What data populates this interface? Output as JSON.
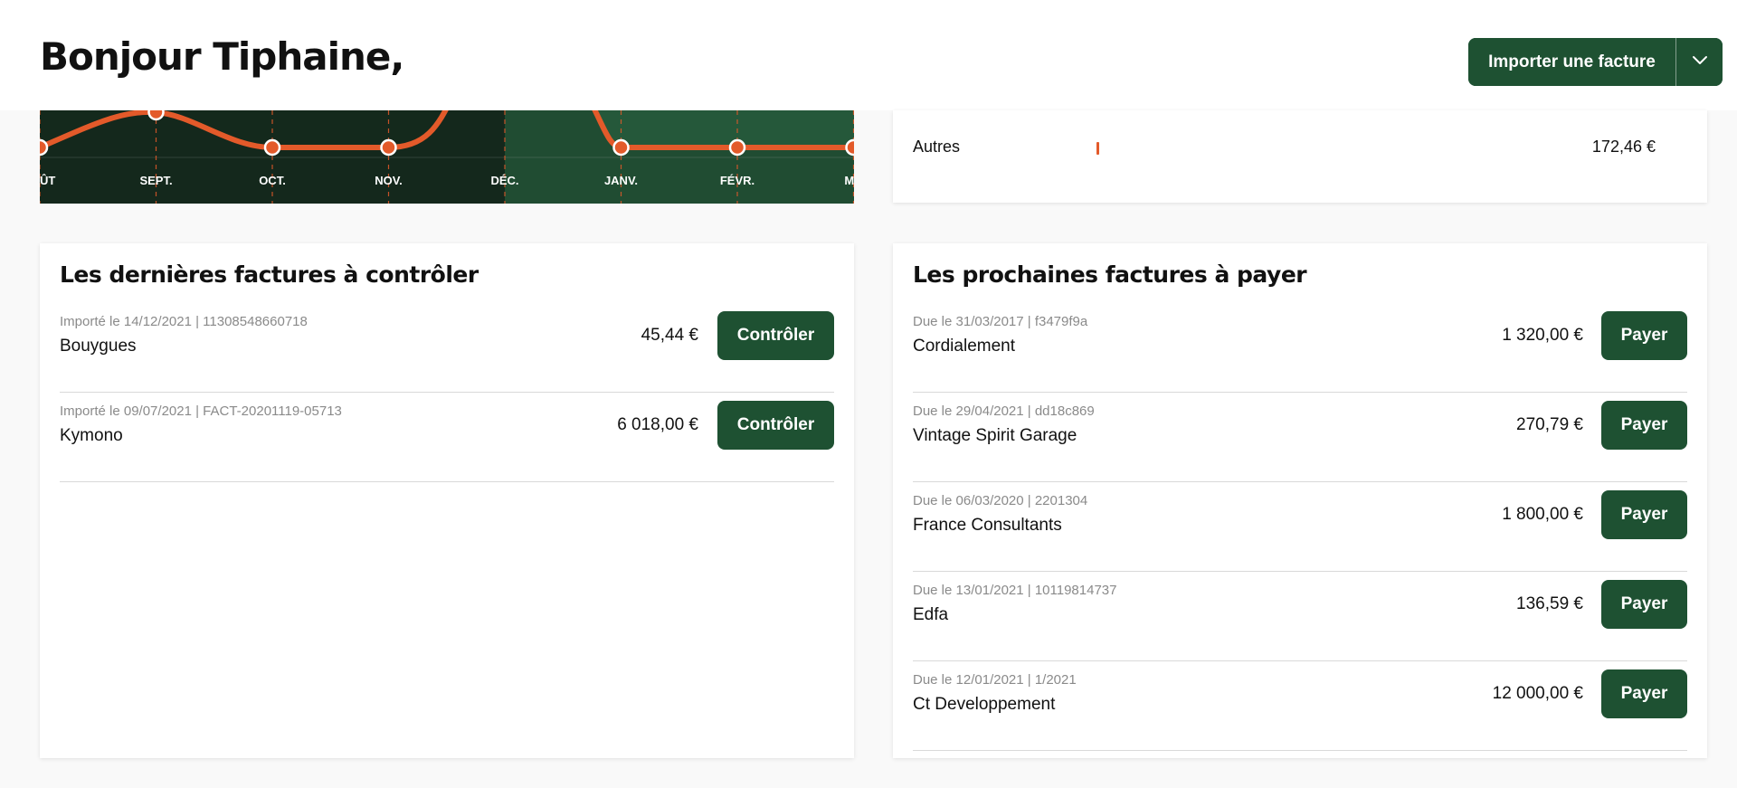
{
  "header": {
    "greeting": "Bonjour Tiphaine,",
    "import_button_label": "Importer une facture",
    "import_dropdown_icon": "chevron-down-icon"
  },
  "chart": {
    "months": [
      "ÛT",
      "SEPT.",
      "OCT.",
      "NOV.",
      "DÉC.",
      "JANV.",
      "FÉVR.",
      "MA"
    ],
    "colors": {
      "background_dark": "#14291c",
      "background_highlight": "#25583a",
      "line": "#e35a2a",
      "label": "#ffffff"
    }
  },
  "breakdown": {
    "label": "Autres",
    "amount": "172,46 €",
    "bar_color": "#e35a2a"
  },
  "to_control": {
    "title": "Les dernières factures à contrôler",
    "action_label": "Contrôler",
    "items": [
      {
        "meta": "Importé le 14/12/2021 | 11308548660718",
        "name": "Bouygues",
        "amount": "45,44 €"
      },
      {
        "meta": "Importé le 09/07/2021 | FACT-20201119-05713",
        "name": "Kymono",
        "amount": "6 018,00 €"
      }
    ]
  },
  "to_pay": {
    "title": "Les prochaines factures à payer",
    "action_label": "Payer",
    "items": [
      {
        "meta": "Due le 31/03/2017 | f3479f9a",
        "name": "Cordialement",
        "amount": "1 320,00 €"
      },
      {
        "meta": "Due le 29/04/2021 | dd18c869",
        "name": "Vintage Spirit Garage",
        "amount": "270,79 €"
      },
      {
        "meta": "Due le 06/03/2020 | 2201304",
        "name": "France Consultants",
        "amount": "1 800,00 €"
      },
      {
        "meta": "Due le 13/01/2021 | 10119814737",
        "name": "Edfa",
        "amount": "136,59 €"
      },
      {
        "meta": "Due le 12/01/2021 | 1/2021",
        "name": "Ct Developpement",
        "amount": "12 000,00 €"
      }
    ]
  },
  "colors": {
    "accent": "#1e5132",
    "divider": "#d9d9d9",
    "meta_text": "#8a8a8a"
  }
}
